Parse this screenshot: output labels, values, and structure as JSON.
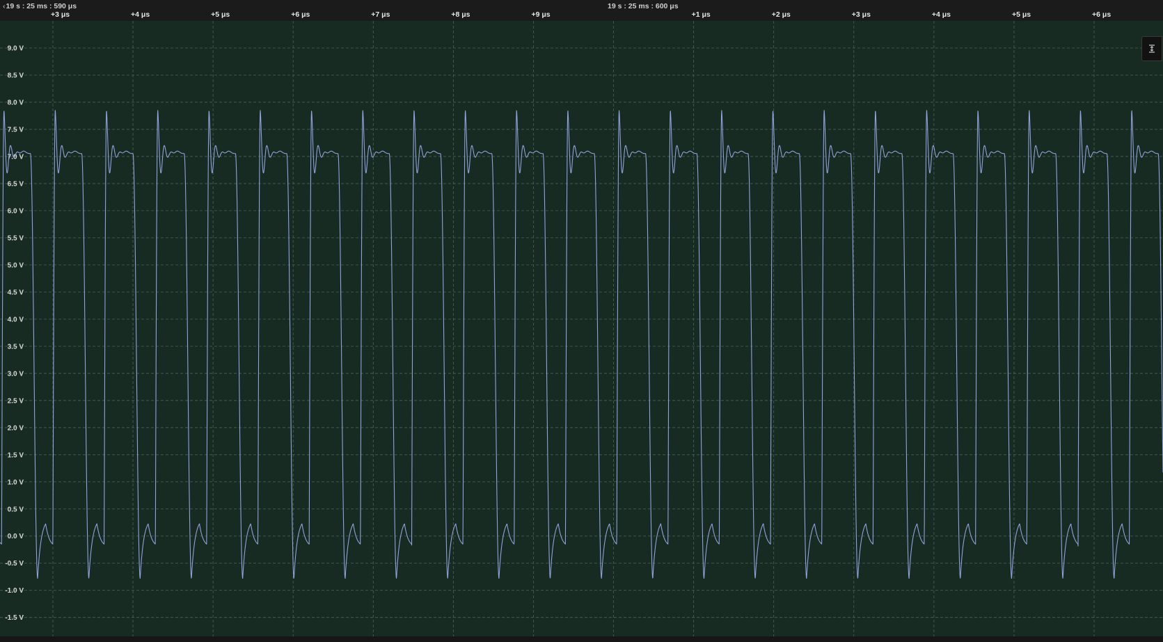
{
  "timeline": {
    "start_absolute": "19 s : 25 ms : 590 μs",
    "mid_absolute": "19 s : 25 ms : 600 μs",
    "ticks": [
      "+3 μs",
      "+4 μs",
      "+5 μs",
      "+6 μs",
      "+7 μs",
      "+8 μs",
      "+9 μs",
      "+1 μs",
      "+2 μs",
      "+3 μs",
      "+4 μs",
      "+5 μs",
      "+6 μs"
    ]
  },
  "colors": {
    "plot_background": "#182b23",
    "grid": "#4a6358",
    "trace": "#8fa3dc"
  },
  "controls": {
    "autoscale_icon": "fit-vertical-icon"
  },
  "chart_data": {
    "type": "line",
    "title": "",
    "xlabel": "",
    "ylabel": "",
    "x_unit": "μs",
    "xlim": [
      2.34,
      16.86
    ],
    "ylim": [
      -1.85,
      9.5
    ],
    "yticks": [
      "9.0 V",
      "8.5 V",
      "8.0 V",
      "7.5 V",
      "7.0 V",
      "6.5 V",
      "6.0 V",
      "5.5 V",
      "5.0 V",
      "4.5 V",
      "4.0 V",
      "3.5 V",
      "3.0 V",
      "2.5 V",
      "2.0 V",
      "1.5 V",
      "1.0 V",
      "0.5 V",
      "0.0 V",
      "-0.5 V",
      "-1.0 V",
      "-1.5 V"
    ],
    "ytick_values": [
      9.0,
      8.5,
      8.0,
      7.5,
      7.0,
      6.5,
      6.0,
      5.5,
      5.0,
      4.5,
      4.0,
      3.5,
      3.0,
      2.5,
      2.0,
      1.5,
      1.0,
      0.5,
      0.0,
      -0.5,
      -1.0,
      -1.5
    ],
    "xgrid": [
      3,
      4,
      5,
      6,
      7,
      8,
      9,
      10,
      11,
      12,
      13,
      14,
      15,
      16
    ],
    "grid": true,
    "series": [
      {
        "period": 0.64,
        "first_rise": 2.36,
        "high_level": 7.05,
        "low_level": -0.2,
        "overshoot_peak": 7.85,
        "undershoot_trough": -0.78,
        "high_duration": 0.36,
        "rise_times": [
          2.36,
          3.0,
          3.64,
          4.28,
          4.92,
          5.56,
          6.2,
          6.84,
          7.48,
          8.12,
          8.76,
          9.4,
          10.04,
          10.68,
          11.32,
          11.96,
          12.6,
          13.24,
          13.88,
          14.52,
          15.16,
          15.8,
          16.44
        ]
      }
    ]
  }
}
